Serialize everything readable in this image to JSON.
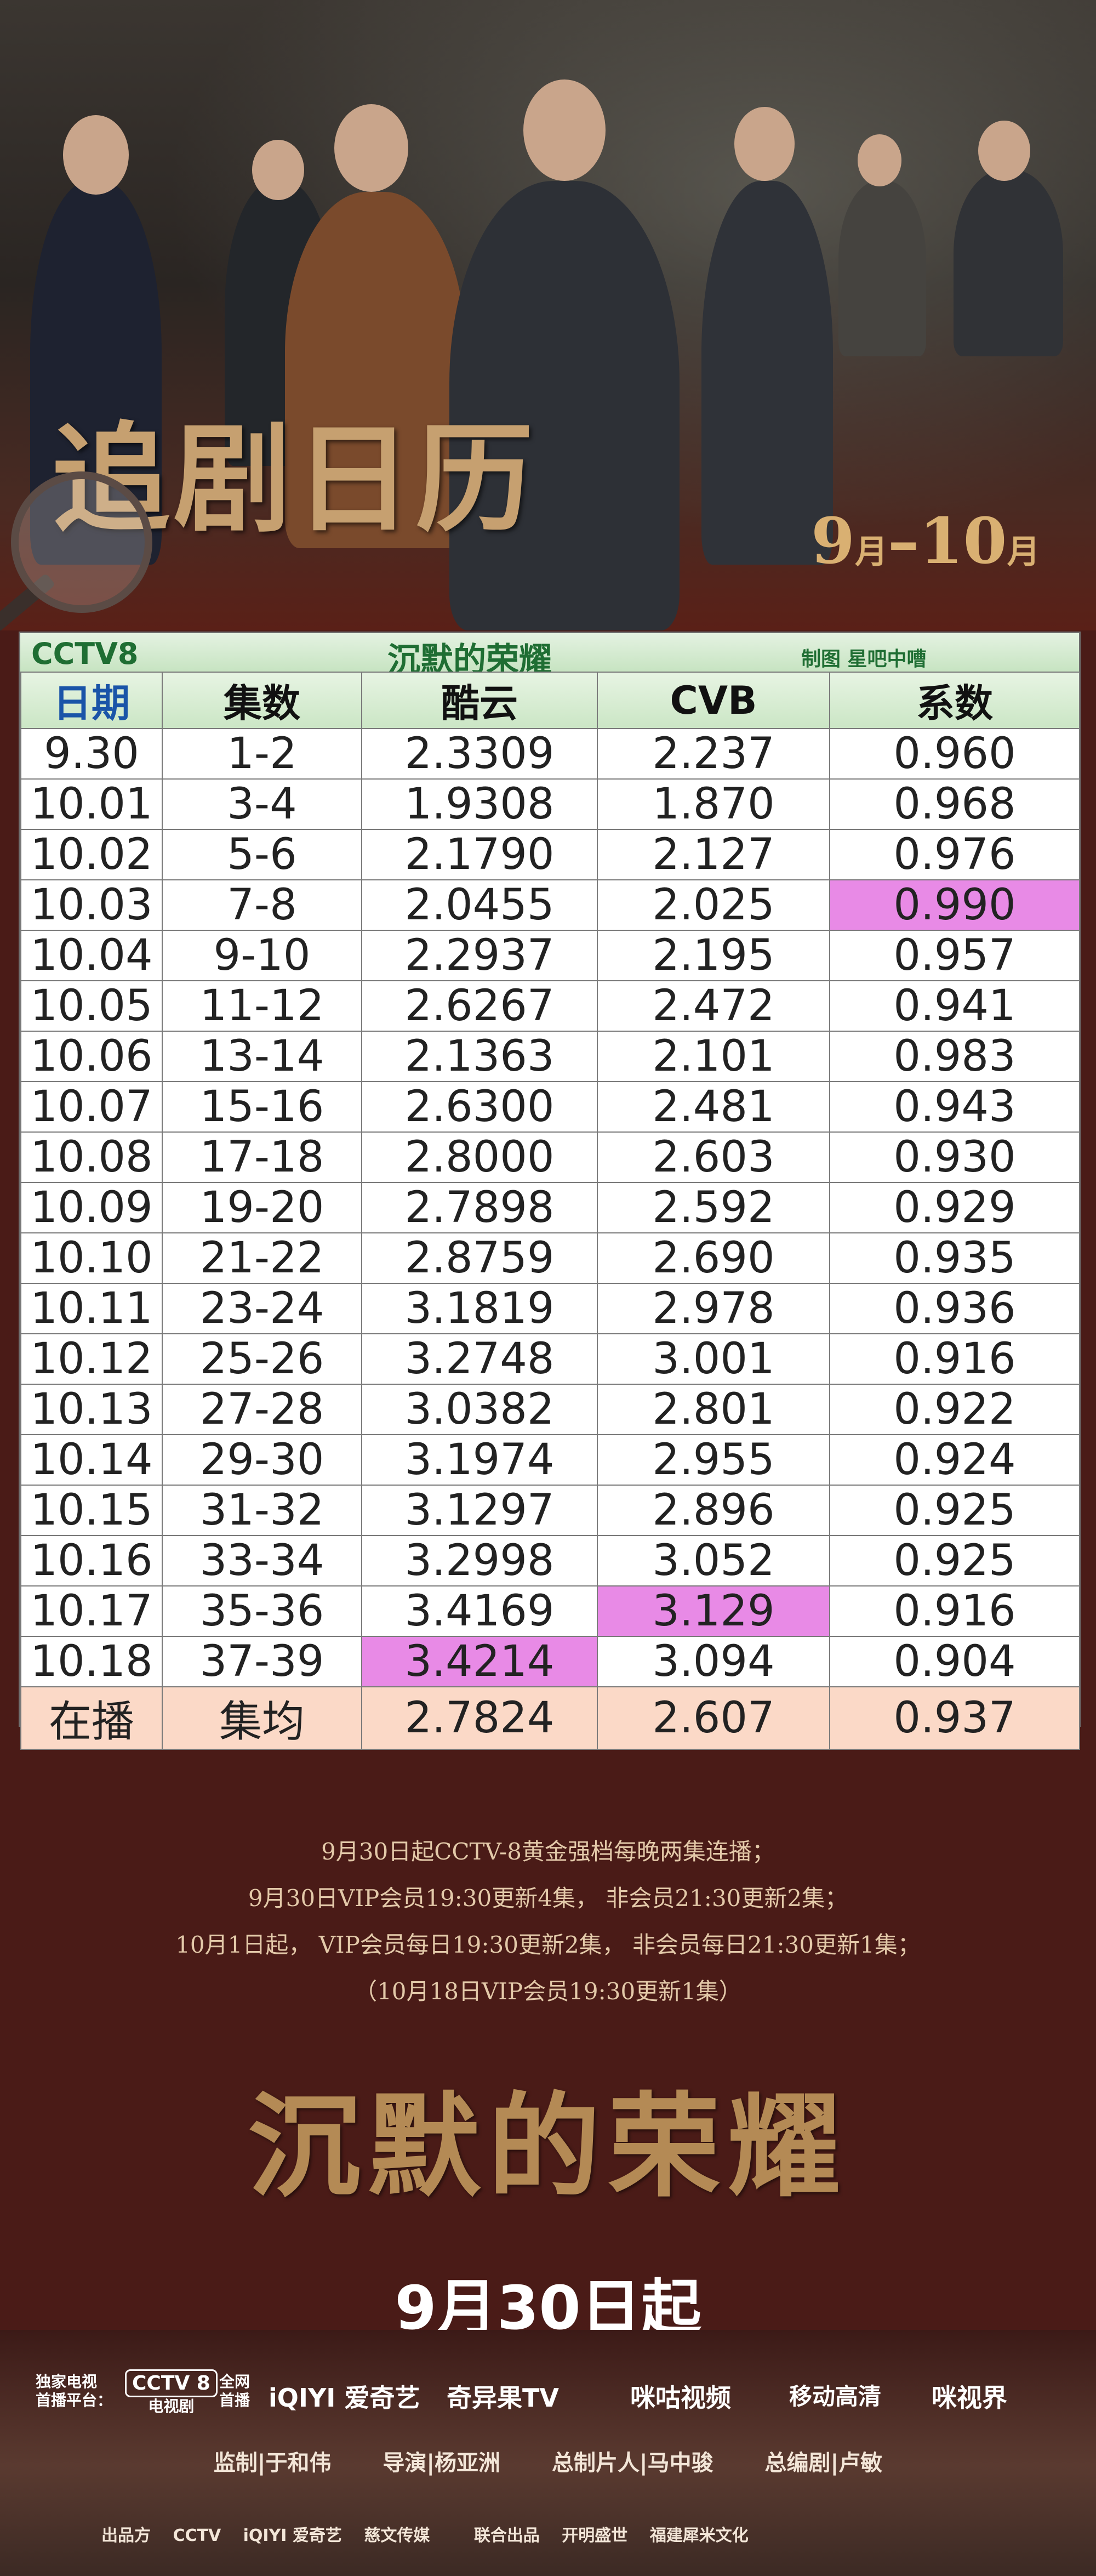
{
  "header": {
    "title": "追剧日历",
    "date_range_start": "9",
    "unit_month": "月",
    "dash": "–",
    "date_range_end": "10"
  },
  "table": {
    "channel": "CCTV8",
    "show_title": "沉默的荣耀",
    "credit": "制图 星吧中嘈",
    "columns": [
      "日期",
      "集数",
      "酷云",
      "CVB",
      "系数"
    ],
    "rows": [
      {
        "date": "9.30",
        "episodes": "1-2",
        "kuyun": "2.3309",
        "cvb": "2.237",
        "coef": "0.960"
      },
      {
        "date": "10.01",
        "episodes": "3-4",
        "kuyun": "1.9308",
        "cvb": "1.870",
        "coef": "0.968"
      },
      {
        "date": "10.02",
        "episodes": "5-6",
        "kuyun": "2.1790",
        "cvb": "2.127",
        "coef": "0.976"
      },
      {
        "date": "10.03",
        "episodes": "7-8",
        "kuyun": "2.0455",
        "cvb": "2.025",
        "coef": "0.990"
      },
      {
        "date": "10.04",
        "episodes": "9-10",
        "kuyun": "2.2937",
        "cvb": "2.195",
        "coef": "0.957"
      },
      {
        "date": "10.05",
        "episodes": "11-12",
        "kuyun": "2.6267",
        "cvb": "2.472",
        "coef": "0.941"
      },
      {
        "date": "10.06",
        "episodes": "13-14",
        "kuyun": "2.1363",
        "cvb": "2.101",
        "coef": "0.983"
      },
      {
        "date": "10.07",
        "episodes": "15-16",
        "kuyun": "2.6300",
        "cvb": "2.481",
        "coef": "0.943"
      },
      {
        "date": "10.08",
        "episodes": "17-18",
        "kuyun": "2.8000",
        "cvb": "2.603",
        "coef": "0.930"
      },
      {
        "date": "10.09",
        "episodes": "19-20",
        "kuyun": "2.7898",
        "cvb": "2.592",
        "coef": "0.929"
      },
      {
        "date": "10.10",
        "episodes": "21-22",
        "kuyun": "2.8759",
        "cvb": "2.690",
        "coef": "0.935"
      },
      {
        "date": "10.11",
        "episodes": "23-24",
        "kuyun": "3.1819",
        "cvb": "2.978",
        "coef": "0.936"
      },
      {
        "date": "10.12",
        "episodes": "25-26",
        "kuyun": "3.2748",
        "cvb": "3.001",
        "coef": "0.916"
      },
      {
        "date": "10.13",
        "episodes": "27-28",
        "kuyun": "3.0382",
        "cvb": "2.801",
        "coef": "0.922"
      },
      {
        "date": "10.14",
        "episodes": "29-30",
        "kuyun": "3.1974",
        "cvb": "2.955",
        "coef": "0.924"
      },
      {
        "date": "10.15",
        "episodes": "31-32",
        "kuyun": "3.1297",
        "cvb": "2.896",
        "coef": "0.925"
      },
      {
        "date": "10.16",
        "episodes": "33-34",
        "kuyun": "3.2998",
        "cvb": "3.052",
        "coef": "0.925"
      },
      {
        "date": "10.17",
        "episodes": "35-36",
        "kuyun": "3.4169",
        "cvb": "3.129",
        "coef": "0.916"
      },
      {
        "date": "10.18",
        "episodes": "37-39",
        "kuyun": "3.4214",
        "cvb": "3.094",
        "coef": "0.904"
      }
    ],
    "average": {
      "date": "在播",
      "episodes": "集均",
      "kuyun": "2.7824",
      "cvb": "2.607",
      "coef": "0.937"
    },
    "highlight_color": "#e88ae6"
  },
  "info_lines": [
    "9月30日起CCTV-8黄金强档每晚两集连播；",
    "9月30日VIP会员19:30更新4集， 非会员21:30更新2集；",
    "10月1日起， VIP会员每日19:30更新2集， 非会员每日21:30更新1集；",
    "（10月18日VIP会员19:30更新1集）"
  ],
  "big_title": "沉默的荣耀",
  "premiere": "9月30日起",
  "platforms": {
    "exclusive_tv": "独家电视",
    "first_platform": "首播平台：",
    "cctv8_logo": "CCTV 8",
    "cctv8_sub": "电视剧",
    "network": "全网",
    "network_first": "首播",
    "iqiyi": "iQIYI 爱奇艺",
    "qiyiguo": "奇异果TV",
    "migu_video": "咪咕视频",
    "mobile_hd": "移动高清",
    "mi_shijie": "咪视界"
  },
  "crew": {
    "supervisor": "监制|于和伟",
    "director": "导演|杨亚洲",
    "producer": "总制片人|马中骏",
    "writer": "总编剧|卢敏"
  },
  "makers": {
    "producer_label": "出品方",
    "cctv": "CCTV",
    "iqiyi": "iQIYI 爱奇艺",
    "ciwen": "慈文传媒",
    "joint_label": "联合出品",
    "kaiming": "开明盛世",
    "fujian": "福建犀米文化"
  }
}
